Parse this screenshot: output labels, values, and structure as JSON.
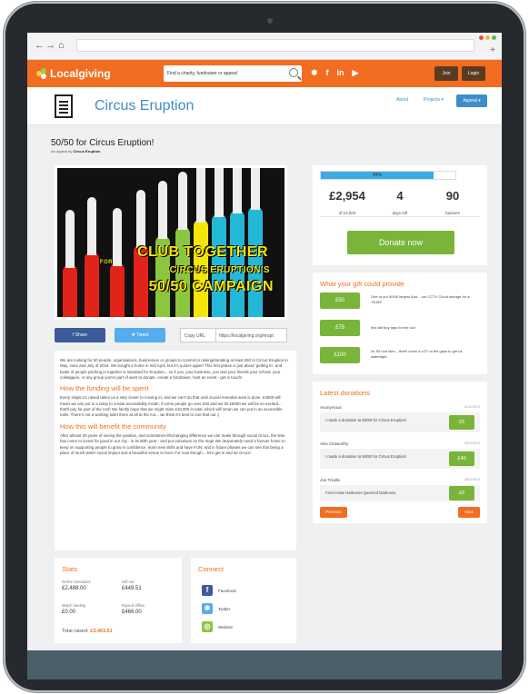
{
  "brand": {
    "name": "Localgiving",
    "accent": "#f26d21",
    "link": "#3d8ec9",
    "green": "#78b53a"
  },
  "header": {
    "search_placeholder": "Find a charity, fundraiser or appeal",
    "social_icons": [
      "twitter-icon",
      "facebook-icon",
      "linkedin-icon",
      "youtube-icon"
    ],
    "social_glyphs": {
      "twitter": "❅",
      "facebook": "f",
      "linkedin": "in",
      "youtube": "▶"
    },
    "join_label": "Join",
    "login_label": "Login"
  },
  "charity": {
    "name": "Circus Eruption",
    "nav_about": "About",
    "nav_projects": "Projects ▾",
    "appeal_label": "Appeal ▾"
  },
  "appeal": {
    "title": "50/50 for Circus Eruption!",
    "by_prefix": "An appeal by",
    "by_name": "Circus Eruption",
    "image_text": [
      "CLUB TOGETHER",
      "FOR",
      "CIRCUS ERUPTION'S",
      "50/50 CAMPAIGN"
    ]
  },
  "share": {
    "facebook_label": "f  Share",
    "twitter_label": "❅  Tweet",
    "copy_label": "Copy URL",
    "url": "https://localgiving.org/erupt"
  },
  "story": {
    "intro": "We are looking for 50 people, organisations, businesses or groups to commit to raising/donating at least £50 to Circus Eruption in May, June and July of 2019. We bought a home in mid April, but it's a doer-upper! This first phase is just about 'getting in', and loads of people pitching in together is standard for Eruption... so if you, your business, you and your friends your school, your colleagues, or any group you're part of want to donate, create a fundraiser, host an event - get in touch!",
    "h_funding": "How the funding will be spent",
    "funding": "Every single £1 raised takes us a step closer to moving in, and we can't do that until crucial remedial work is done. £2500 will mean we can put in a ramp to create accessibility inside; if some people go over £50 and we hit £5000 we will be so excited... that'll pay for part of the roof! We faintly hope that we might raise £10,000 in total, which will mean we can put in an accessible toilet. There's not a working toilet there at all at the mo... we think it's best to sort that out :)",
    "h_benefit": "How this will benefit the community",
    "benefit": "After almost 30 years of seeing the positive, and sometimes lifechanging difference we can make through social circus, the time has come to invest for good in our city - in its 50th year - and put ourselves on the map! We desperately need a forever home to keep on supporting people to grow in confidence, learn new skills and have FUN, and in future phases we can see this being a place of much-wider social impact and a beautiful venue to boot. For now though... let's get in and do circus!"
  },
  "stats": {
    "title": "Stats",
    "online_label": "Online donations",
    "online_value": "£2,488.00",
    "giftaid_label": "Gift Aid",
    "giftaid_value": "£449.51",
    "match_label": "Match funding",
    "match_value": "£0.00",
    "offline_label": "Raised offline",
    "offline_value": "£466.00",
    "total_label": "Total raised:",
    "total_value": "£3,403.51"
  },
  "connect": {
    "title": "Connect",
    "facebook": "Facebook",
    "twitter": "Twitter",
    "website": "Website"
  },
  "progress": {
    "percent_label": "84%",
    "fraction": 0.84,
    "raised": "£2,954",
    "target": "of £3,500",
    "days": "4",
    "days_label": "days left",
    "backers": "90",
    "backers_label": "backers",
    "donate_label": "Donate now"
  },
  "gifts": {
    "title": "What your gift could provide",
    "items": [
      {
        "amount": "£50",
        "desc": "One of our 50/50 largest And... our CCTV Cloud storage for a YEAR!"
      },
      {
        "amount": "£75",
        "desc": "this will buy taps for the loo!"
      },
      {
        "amount": "£100",
        "desc": "for 50 roof tiles... that'll cover a LOT of the gaps to get us watertight."
      }
    ]
  },
  "donations": {
    "title": "Latest donations",
    "items": [
      {
        "name": "Anonymous",
        "date": "01/11/2019",
        "msg": "I made a donation to 50/50 for Circus Eruption!",
        "amount": "£5"
      },
      {
        "name": "Alex Clotworthy",
        "date": "28/11/2019",
        "msg": "I made a donation to 50/50 for Circus Eruption!",
        "amount": "£40"
      },
      {
        "name": "Joe Trindle",
        "date": "28/11/2019",
        "msg": "From Katie Harkness Queenof Darkness",
        "amount": "£5"
      }
    ],
    "prev_label": "Previous",
    "next_label": "Next"
  }
}
